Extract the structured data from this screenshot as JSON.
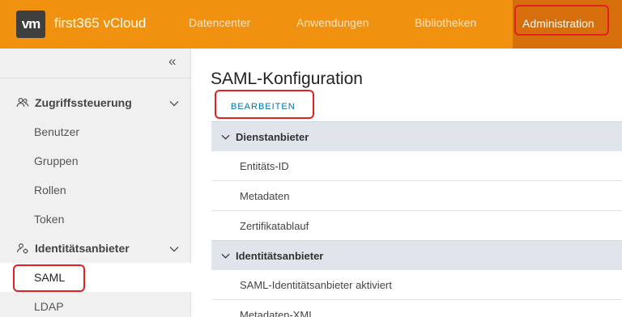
{
  "header": {
    "logo_text": "vm",
    "app_title": "first365 vCloud",
    "nav": [
      {
        "label": "Datencenter"
      },
      {
        "label": "Anwendungen"
      },
      {
        "label": "Bibliotheken"
      },
      {
        "label": "Administration",
        "active": true
      }
    ],
    "colors": {
      "header_bg": "#f0920f",
      "active_tab_bg": "#d66f0b",
      "highlight_border": "#e22020"
    }
  },
  "sidebar": {
    "collapse_icon": "double-chevron-left-icon",
    "groups": [
      {
        "label": "Zugriffssteuerung",
        "icon": "users-icon",
        "expanded": true,
        "items": [
          {
            "label": "Benutzer"
          },
          {
            "label": "Gruppen"
          },
          {
            "label": "Rollen"
          },
          {
            "label": "Token"
          }
        ]
      },
      {
        "label": "Identitätsanbieter",
        "icon": "identity-provider-icon",
        "expanded": true,
        "items": [
          {
            "label": "SAML",
            "active": true
          },
          {
            "label": "LDAP"
          }
        ]
      }
    ]
  },
  "main": {
    "title": "SAML-Konfiguration",
    "edit_button": "BEARBEITEN",
    "sections": [
      {
        "label": "Dienstanbieter",
        "rows": [
          {
            "label": "Entitäts-ID"
          },
          {
            "label": "Metadaten"
          },
          {
            "label": "Zertifikatablauf"
          }
        ]
      },
      {
        "label": "Identitätsanbieter",
        "rows": [
          {
            "label": "SAML-Identitätsanbieter aktiviert"
          },
          {
            "label": "Metadaten-XML"
          }
        ]
      }
    ]
  }
}
